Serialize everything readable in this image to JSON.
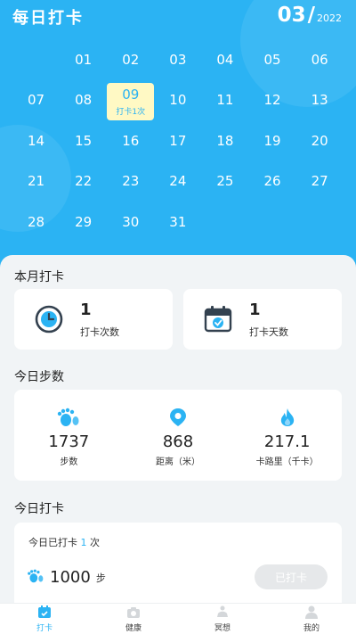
{
  "header": {
    "title": "每日打卡",
    "month": "03",
    "slash": "/",
    "year": "2022"
  },
  "calendar": {
    "leading_blanks": 1,
    "days": [
      "01",
      "02",
      "03",
      "04",
      "05",
      "06",
      "07",
      "08",
      "09",
      "10",
      "11",
      "12",
      "13",
      "14",
      "15",
      "16",
      "17",
      "18",
      "19",
      "20",
      "21",
      "22",
      "23",
      "24",
      "25",
      "26",
      "27",
      "28",
      "29",
      "30",
      "31"
    ],
    "active_day": "09",
    "active_tag": "打卡1次"
  },
  "monthly": {
    "title": "本月打卡",
    "checkins": {
      "value": "1",
      "label": "打卡次数",
      "icon": "clock-icon"
    },
    "days": {
      "value": "1",
      "label": "打卡天数",
      "icon": "calendar-check-icon"
    }
  },
  "steps": {
    "title": "今日步数",
    "items": [
      {
        "icon": "footprint-icon",
        "value": "1737",
        "label": "步数"
      },
      {
        "icon": "location-pin-icon",
        "value": "868",
        "label": "距离（米）"
      },
      {
        "icon": "flame-icon",
        "value": "217.1",
        "label": "卡路里（千卡）"
      }
    ]
  },
  "today": {
    "title": "今日打卡",
    "done_prefix": "今日已打卡",
    "done_count": "1",
    "done_suffix": "次",
    "goal_value": "1000",
    "goal_unit": "步",
    "button_label": "已打卡"
  },
  "tabs": [
    {
      "label": "打卡",
      "icon": "checkin-tab-icon",
      "active": true
    },
    {
      "label": "健康",
      "icon": "camera-tab-icon",
      "active": false
    },
    {
      "label": "冥想",
      "icon": "meditation-tab-icon",
      "active": false
    },
    {
      "label": "我的",
      "icon": "profile-tab-icon",
      "active": false
    }
  ],
  "colors": {
    "accent": "#2bb3f3",
    "active_day_bg": "#fff9c4",
    "flame": "#2bb3f3"
  }
}
